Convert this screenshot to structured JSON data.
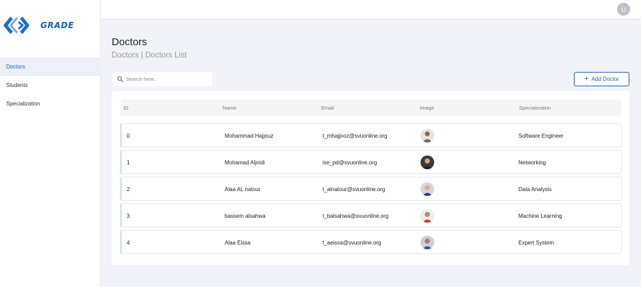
{
  "brand": {
    "name": "GRADE"
  },
  "sidebar": {
    "items": [
      {
        "label": "Doctors",
        "active": true
      },
      {
        "label": "Students",
        "active": false
      },
      {
        "label": "Specialization",
        "active": false
      }
    ]
  },
  "header": {
    "avatar_letter": "U"
  },
  "page": {
    "title": "Doctors",
    "breadcrumb": "Doctors | Doctors List"
  },
  "search": {
    "placeholder": "Search here.."
  },
  "actions": {
    "add_label": "Add Doctor"
  },
  "table": {
    "headers": [
      "ID",
      "Name",
      "Email",
      "Image",
      "Specialization"
    ],
    "rows": [
      {
        "id": "0",
        "name": "Mohammad Hajjouz",
        "email": "t_mhajjooz@svuonline.org",
        "specialization": "Software Engineer"
      },
      {
        "id": "1",
        "name": "Mohamad Aljnidi",
        "email": "ise_pd@svuonline.org",
        "specialization": "Networking"
      },
      {
        "id": "2",
        "name": "Alaa AL natour",
        "email": "t_alnatour@svuonline.org",
        "specialization": "Data Analysis"
      },
      {
        "id": "3",
        "name": "bassem alsahwa",
        "email": "t_balsahwa@svuonline.org",
        "specialization": "Machine Learning"
      },
      {
        "id": "4",
        "name": "Alaa Eissa",
        "email": "t_aeissa@svuonline.org",
        "specialization": "Expert System"
      }
    ]
  },
  "colors": {
    "brand": "#1f5fa8",
    "logo_blue": "#1a6fd0",
    "active_bg": "#edf0f7",
    "row_accent": "#d3ecd8"
  }
}
